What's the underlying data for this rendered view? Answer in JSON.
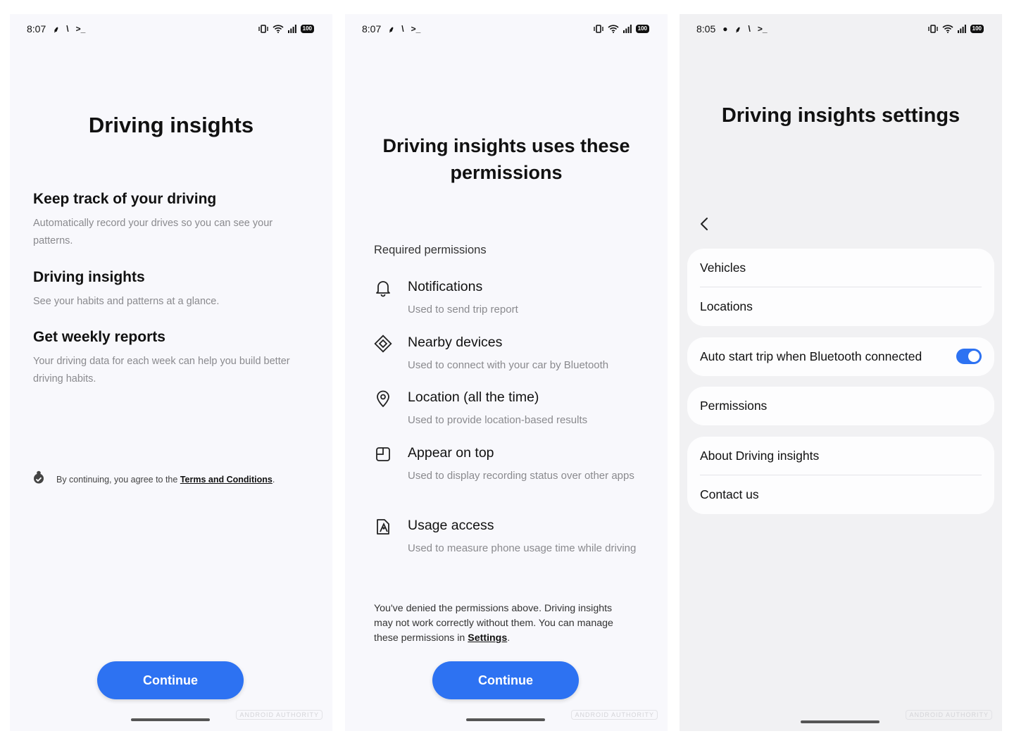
{
  "screen1": {
    "status_time": "8:07",
    "battery": "100",
    "title": "Driving insights",
    "features": [
      {
        "heading": "Keep track of your driving",
        "text": "Automatically record your drives so you can see your patterns."
      },
      {
        "heading": "Driving insights",
        "text": "See your habits and patterns at a glance."
      },
      {
        "heading": "Get weekly reports",
        "text": "Your driving data for each week can help you build better driving habits."
      }
    ],
    "terms_prefix": "By continuing, you agree to the ",
    "terms_link": "Terms and Conditions",
    "terms_suffix": ".",
    "continue_label": "Continue",
    "watermark": "ANDROID AUTHORITY"
  },
  "screen2": {
    "status_time": "8:07",
    "battery": "100",
    "title": "Driving insights uses these permissions",
    "required_label": "Required permissions",
    "permissions": [
      {
        "icon": "bell-icon",
        "title": "Notifications",
        "desc": "Used to send trip report"
      },
      {
        "icon": "nearby-devices-icon",
        "title": "Nearby devices",
        "desc": "Used to connect with your car by Bluetooth"
      },
      {
        "icon": "location-pin-icon",
        "title": "Location (all the time)",
        "desc": "Used to provide location-based results"
      },
      {
        "icon": "appear-on-top-icon",
        "title": "Appear on top",
        "desc": "Used to display recording status over other apps"
      },
      {
        "icon": "usage-access-icon",
        "title": "Usage access",
        "desc": "Used to measure phone usage time while driving"
      }
    ],
    "denied_text": "You've denied the permissions above. Driving insights may not work correctly without them. You can manage these permissions in ",
    "settings_link": "Settings",
    "denied_suffix": ".",
    "continue_label": "Continue",
    "watermark": "ANDROID AUTHORITY"
  },
  "screen3": {
    "status_time": "8:05",
    "battery": "100",
    "title": "Driving insights settings",
    "card1": [
      "Vehicles",
      "Locations"
    ],
    "auto_start_label": "Auto start trip when Bluetooth connected",
    "auto_start_on": true,
    "permissions_label": "Permissions",
    "card3": [
      "About Driving insights",
      "Contact us"
    ],
    "watermark": "ANDROID AUTHORITY"
  },
  "colors": {
    "accent": "#2d72f2",
    "secondary_text": "#8a8a8e"
  }
}
